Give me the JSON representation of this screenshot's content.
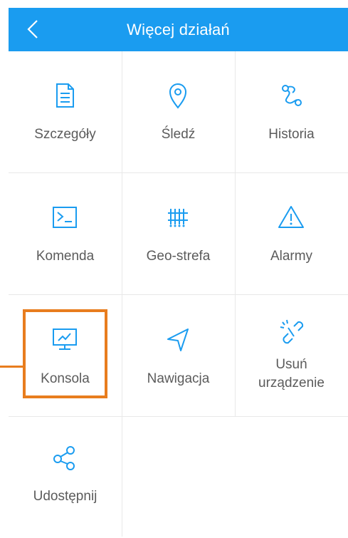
{
  "header": {
    "title": "Więcej działań",
    "back_icon": "chevron-left-icon"
  },
  "colors": {
    "accent": "#1a9cf0",
    "highlight": "#e87d1e",
    "label": "#5b5b5b"
  },
  "actions": [
    {
      "label": "Szczegóły",
      "icon": "document-icon"
    },
    {
      "label": "Śledź",
      "icon": "location-pin-icon"
    },
    {
      "label": "Historia",
      "icon": "route-icon"
    },
    {
      "label": "Komenda",
      "icon": "terminal-icon"
    },
    {
      "label": "Geo-strefa",
      "icon": "geofence-icon"
    },
    {
      "label": "Alarmy",
      "icon": "warning-icon"
    },
    {
      "label": "Konsola",
      "icon": "monitor-chart-icon"
    },
    {
      "label": "Nawigacja",
      "icon": "navigation-arrow-icon"
    },
    {
      "label_line1": "Usuń",
      "label_line2": "urządzenie",
      "icon": "unlink-icon"
    },
    {
      "label": "Udostępnij",
      "icon": "share-icon"
    }
  ]
}
